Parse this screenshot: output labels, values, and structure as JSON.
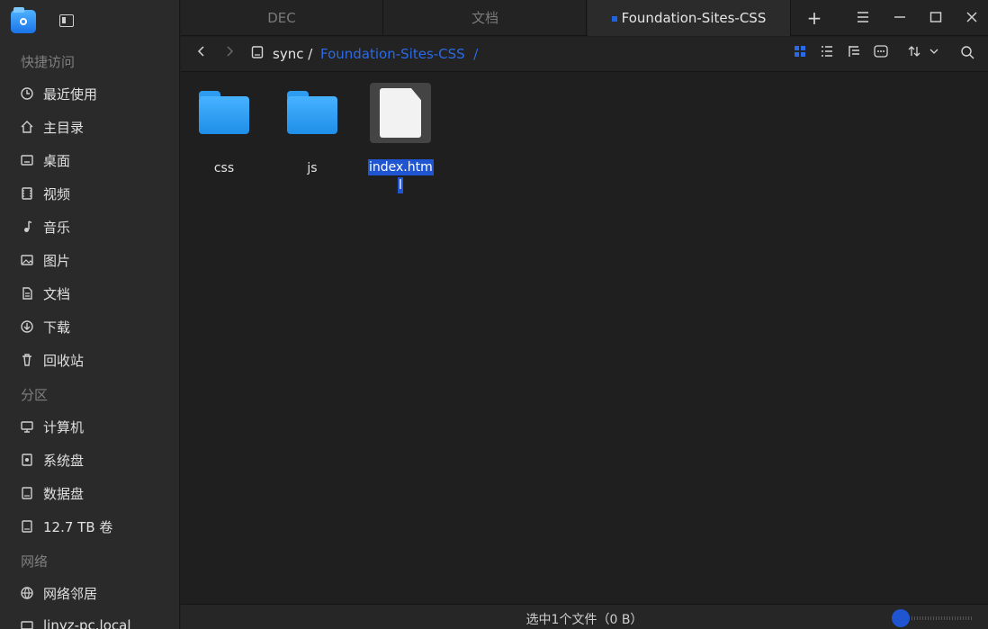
{
  "sidebar": {
    "sections": [
      {
        "title": "快捷访问",
        "items": [
          {
            "label": "最近使用",
            "icon": "clock-icon"
          },
          {
            "label": "主目录",
            "icon": "home-icon"
          },
          {
            "label": "桌面",
            "icon": "desktop-icon"
          },
          {
            "label": "视频",
            "icon": "video-icon"
          },
          {
            "label": "音乐",
            "icon": "music-icon"
          },
          {
            "label": "图片",
            "icon": "image-icon"
          },
          {
            "label": "文档",
            "icon": "document-icon"
          },
          {
            "label": "下载",
            "icon": "download-icon"
          },
          {
            "label": "回收站",
            "icon": "trash-icon"
          }
        ]
      },
      {
        "title": "分区",
        "items": [
          {
            "label": "计算机",
            "icon": "computer-icon"
          },
          {
            "label": "系统盘",
            "icon": "disk-icon"
          },
          {
            "label": "数据盘",
            "icon": "disk-icon"
          },
          {
            "label": "12.7 TB 卷",
            "icon": "disk-icon"
          }
        ]
      },
      {
        "title": "网络",
        "items": [
          {
            "label": "网络邻居",
            "icon": "network-icon"
          },
          {
            "label": "linyz-pc.local",
            "icon": "network-drive-icon"
          }
        ]
      }
    ]
  },
  "tabs": [
    {
      "label": "DEC",
      "active": false
    },
    {
      "label": "文档",
      "active": false
    },
    {
      "label": "Foundation-Sites-CSS",
      "active": true
    }
  ],
  "breadcrumb": {
    "root": "sync",
    "current": "Foundation-Sites-CSS",
    "separator": "/"
  },
  "files": [
    {
      "name": "css",
      "type": "folder"
    },
    {
      "name": "js",
      "type": "folder"
    },
    {
      "name": "index.html",
      "name_line1": "index.htm",
      "name_line2": "l",
      "type": "file",
      "selected": true
    }
  ],
  "status": {
    "text": "选中1个文件（0 B）"
  },
  "colors": {
    "accent": "#1f55d1",
    "folder": "#2d9bf0",
    "background": "#1f1f1f",
    "sidebar": "#2a2a2a"
  }
}
